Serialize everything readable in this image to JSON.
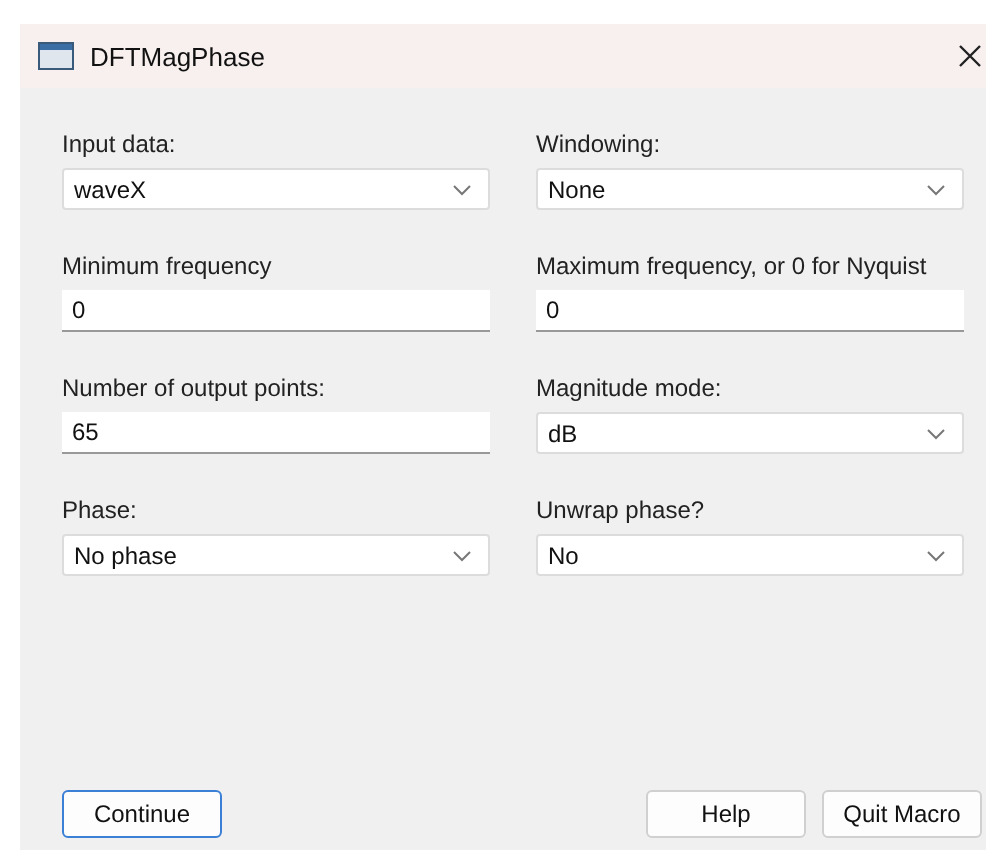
{
  "window": {
    "title": "DFTMagPhase"
  },
  "fields": [
    {
      "label": "Input data:",
      "kind": "select",
      "value": "waveX"
    },
    {
      "label": "Windowing:",
      "kind": "select",
      "value": "None"
    },
    {
      "label": "Minimum frequency",
      "kind": "text",
      "value": "0"
    },
    {
      "label": "Maximum frequency, or 0 for Nyquist",
      "kind": "text",
      "value": "0"
    },
    {
      "label": "Number of output points:",
      "kind": "text",
      "value": "65"
    },
    {
      "label": "Magnitude mode:",
      "kind": "select",
      "value": "dB"
    },
    {
      "label": "Phase:",
      "kind": "select",
      "value": "No phase"
    },
    {
      "label": "Unwrap phase?",
      "kind": "select",
      "value": "No"
    }
  ],
  "buttons": [
    {
      "label": "Continue",
      "default": true
    },
    {
      "label": "Help",
      "default": false
    },
    {
      "label": "Quit Macro",
      "default": false
    }
  ]
}
